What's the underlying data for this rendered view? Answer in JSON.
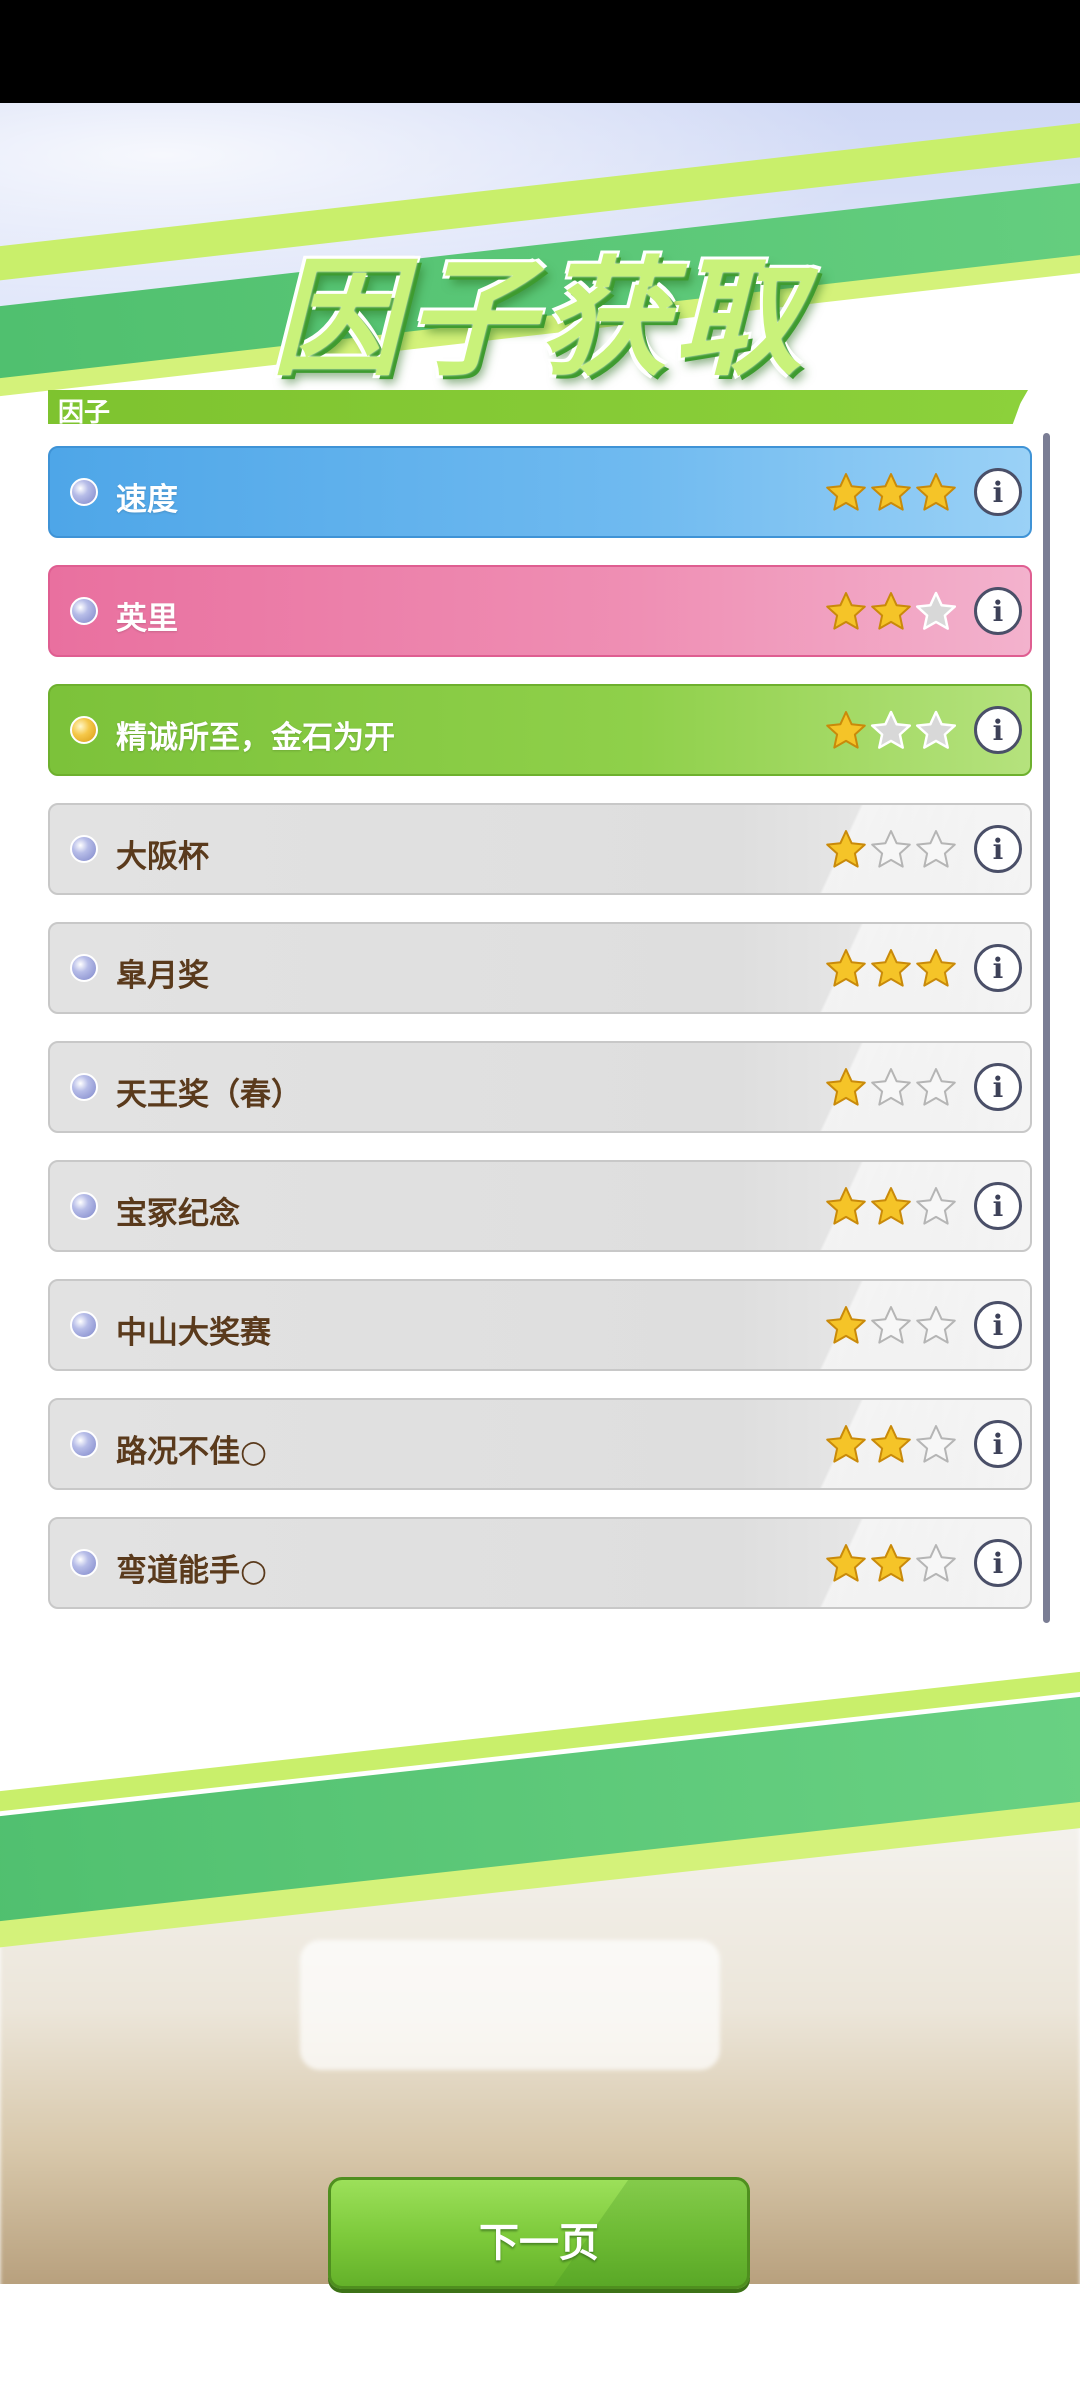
{
  "title": "因子获取",
  "section_label": "因子",
  "factors": [
    {
      "name": "速度",
      "rating": 3,
      "type": "blue"
    },
    {
      "name": "英里",
      "rating": 2,
      "type": "pink"
    },
    {
      "name": "精诚所至，金石为开",
      "rating": 1,
      "type": "green"
    },
    {
      "name": "大阪杯",
      "rating": 1,
      "type": "grey"
    },
    {
      "name": "皐月奖",
      "rating": 3,
      "type": "grey"
    },
    {
      "name": "天王奖（春）",
      "rating": 1,
      "type": "grey"
    },
    {
      "name": "宝冢纪念",
      "rating": 2,
      "type": "grey"
    },
    {
      "name": "中山大奖赛",
      "rating": 1,
      "type": "grey"
    },
    {
      "name": "路况不佳○",
      "rating": 2,
      "type": "grey"
    },
    {
      "name": "弯道能手○",
      "rating": 2,
      "type": "grey"
    }
  ],
  "info_icon_text": "i",
  "next_button": "下一页",
  "colors": {
    "blue": "#4ea6e8",
    "pink": "#e9709f",
    "green": "#7cc23a",
    "grey": "#e0e0e0",
    "star_filled": "#f5c428",
    "accent": "#8cd13b"
  }
}
